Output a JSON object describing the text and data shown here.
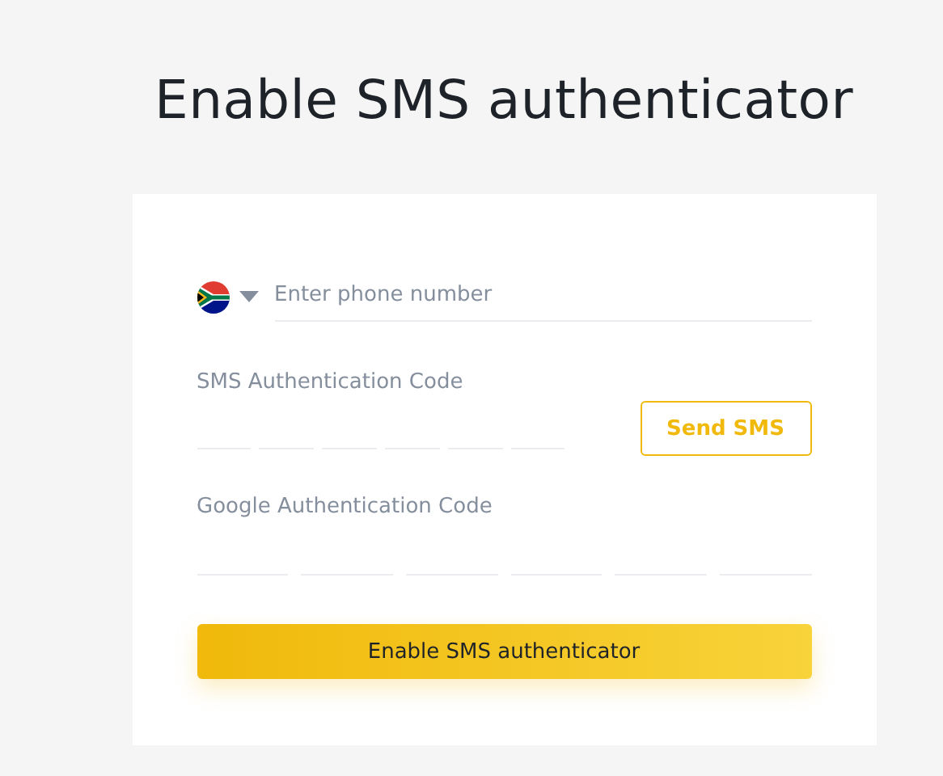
{
  "title": "Enable SMS authenticator",
  "phone": {
    "placeholder": "Enter phone number"
  },
  "sms_code": {
    "label": "SMS Authentication Code",
    "button": "Send SMS"
  },
  "google_code": {
    "label": "Google Authentication Code"
  },
  "submit": "Enable SMS authenticator"
}
